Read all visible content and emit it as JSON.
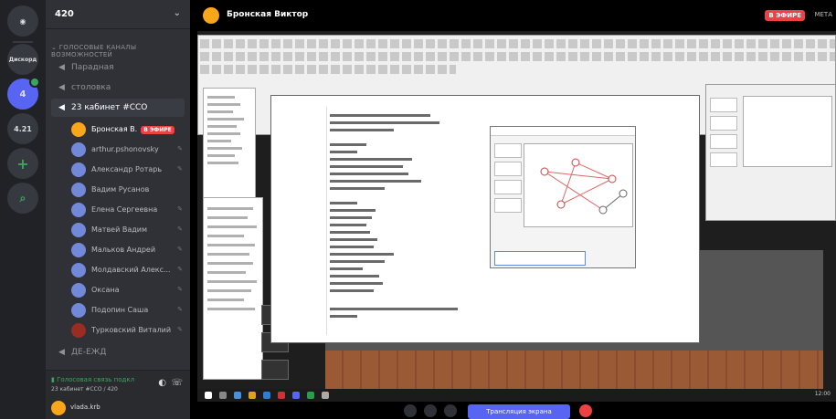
{
  "rail": {
    "home_label": "Дискорд",
    "server_badge": "4",
    "server_count": "4.21"
  },
  "server": {
    "name": "420"
  },
  "sidebar": {
    "category": "ГОЛОСОВЫЕ КАНАЛЫ ВОЗМОЖНОСТЕЙ",
    "channels": [
      {
        "name": "Парадная"
      },
      {
        "name": "столовка"
      },
      {
        "name": "23 кабинет #ССО"
      }
    ],
    "users": [
      {
        "name": "Бронская В.",
        "live": "В ЭФИРЕ"
      },
      {
        "name": "arthur.pshonovsky"
      },
      {
        "name": "Александр Ротарь"
      },
      {
        "name": "Вадим Русанов"
      },
      {
        "name": "Елена Сергеевна"
      },
      {
        "name": "Матвей Вадим"
      },
      {
        "name": "Мальков Андрей"
      },
      {
        "name": "Молдавский Алекс..."
      },
      {
        "name": "Оксана"
      },
      {
        "name": "Подопин Саша"
      },
      {
        "name": "Турковский Виталий"
      }
    ],
    "extra_channel": "ДЕ-ЕЖД"
  },
  "voice": {
    "status": "Голосовая связь подкл",
    "sub": "23 кабинет #ССО / 420"
  },
  "user_panel": {
    "name": "vlada.krb"
  },
  "stream": {
    "title": "Бронская Виктор",
    "live": "В ЭФИРЕ",
    "meta": "МЕТА"
  },
  "taskbar": {
    "clock": "12:00"
  },
  "controls": {
    "screen_button": "Трансляция экрана"
  },
  "colors": {
    "accent": "#5865f2",
    "live": "#ed4245",
    "connected": "#3ba55d"
  }
}
